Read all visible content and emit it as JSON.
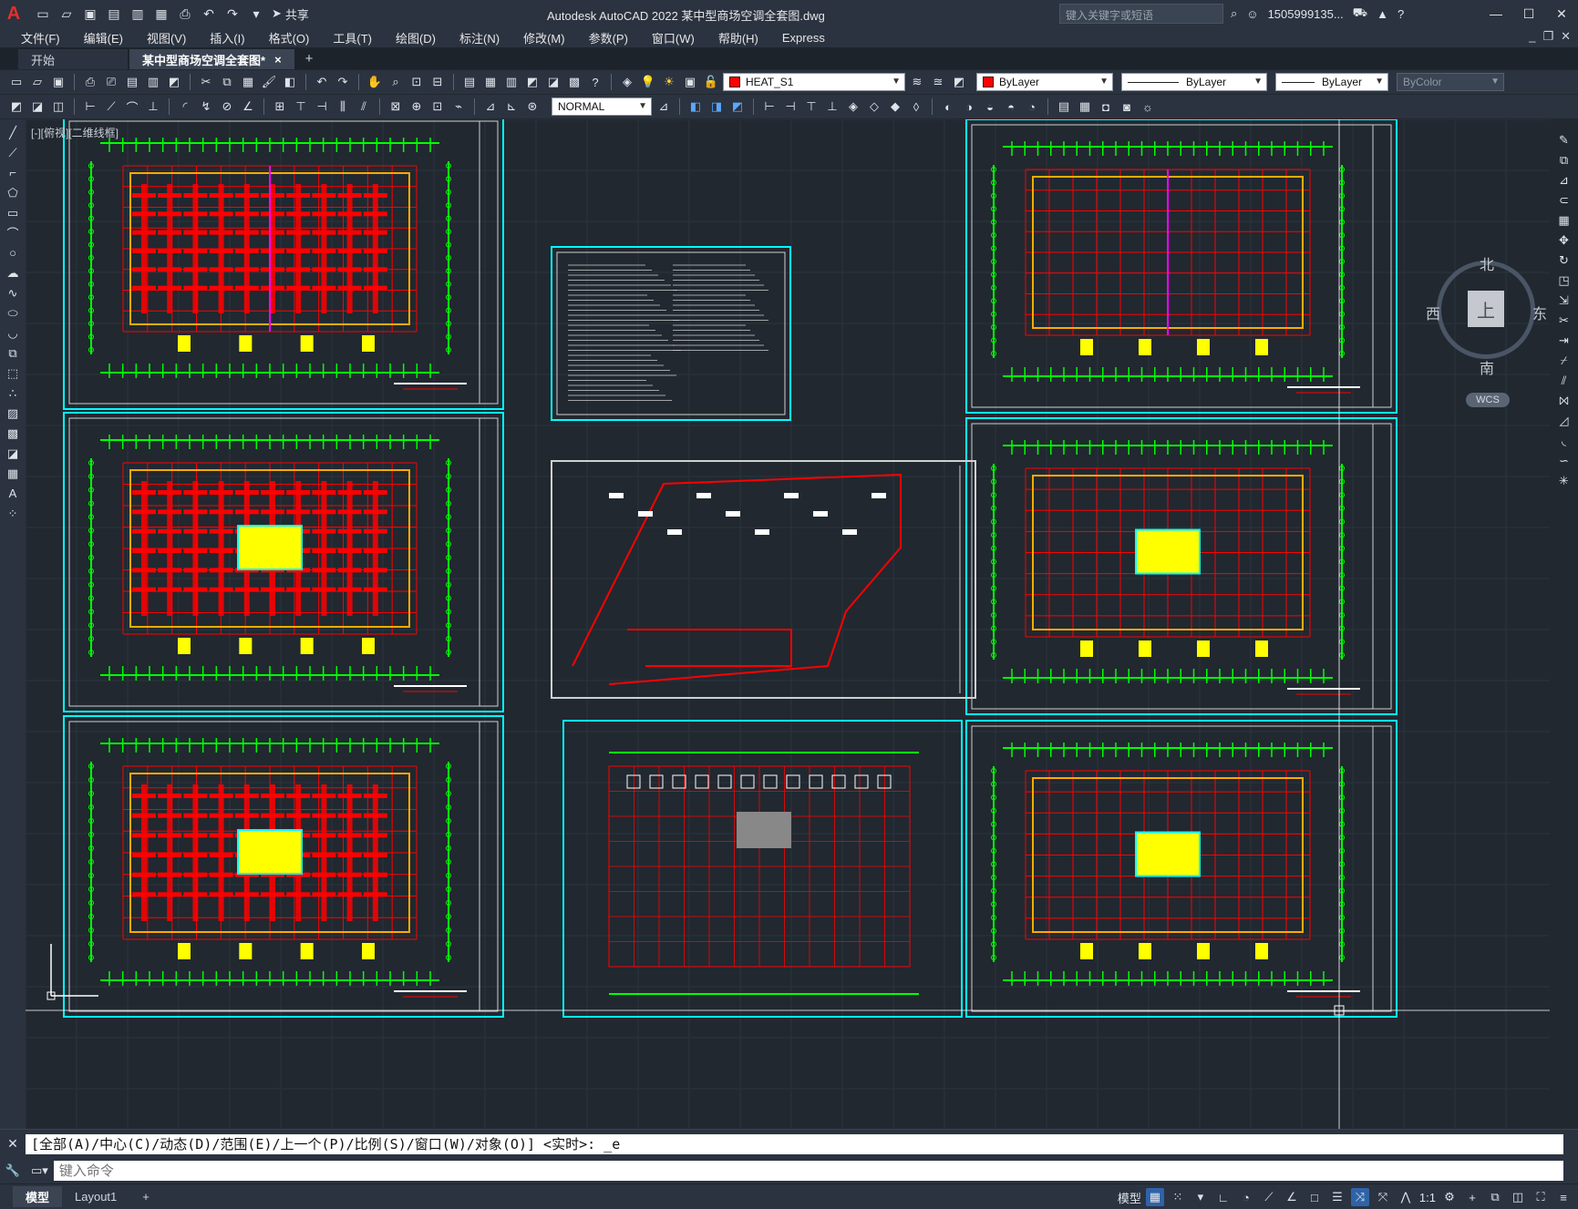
{
  "app": {
    "title": "Autodesk AutoCAD 2022    某中型商场空调全套图.dwg",
    "search_placeholder": "键入关键字或短语",
    "user": "1505999135...",
    "share_label": "共享",
    "logo_letter": "A"
  },
  "menus": [
    "文件(F)",
    "编辑(E)",
    "视图(V)",
    "插入(I)",
    "格式(O)",
    "工具(T)",
    "绘图(D)",
    "标注(N)",
    "修改(M)",
    "参数(P)",
    "窗口(W)",
    "帮助(H)",
    "Express"
  ],
  "tabs": {
    "start": "开始",
    "drawing": "某中型商场空调全套图*",
    "close": "×",
    "add": "+"
  },
  "toolbar": {
    "layer_name": "HEAT_S1",
    "color": "ByLayer",
    "linetype": "ByLayer",
    "lineweight": "ByLayer",
    "plotstyle": "ByColor",
    "visual_style": "NORMAL"
  },
  "viewport": {
    "label": "[-][俯视][二维线框]"
  },
  "viewcube": {
    "top": "上",
    "north": "北",
    "south": "南",
    "east": "东",
    "west": "西",
    "wcs": "WCS"
  },
  "command": {
    "history": "[全部(A)/中心(C)/动态(D)/范围(E)/上一个(P)/比例(S)/窗口(W)/对象(O)] <实时>: _e",
    "placeholder": "键入命令"
  },
  "status": {
    "model_tab": "模型",
    "layout_tab": "Layout1",
    "add": "+",
    "model_label": "模型",
    "scale": "1:1"
  },
  "colors": {
    "accent_cyan": "#00ffff",
    "plan_red": "#ff0000",
    "grid_green": "#00ff00",
    "highlight_yellow": "#ffff00",
    "magenta": "#ff00ff",
    "canvas_bg": "#212830"
  }
}
